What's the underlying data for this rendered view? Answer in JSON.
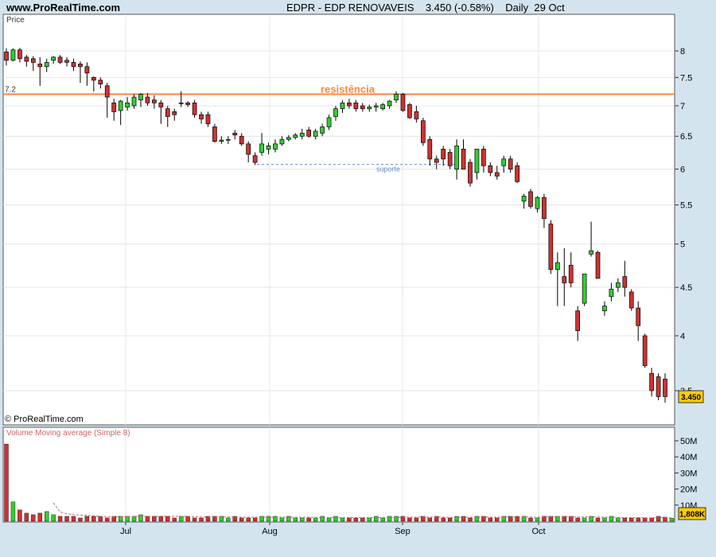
{
  "header": {
    "site": "www.ProRealTime.com",
    "ticker": "EDPR - EDP RENOVAVEIS",
    "quote": "3.450 (-0.58%)",
    "period": "Daily",
    "date": "29 Oct"
  },
  "price_panel": {
    "label": "Price",
    "copyright": "© ProRealTime.com",
    "resistance_label": "resistência",
    "resistance_level_label": "7.2",
    "support_label": "suporte",
    "last_price_tag": "3.450",
    "colors": {
      "up": "#33cc33",
      "down": "#cc3333",
      "resistance": "#ff8833",
      "support": "#6688cc"
    }
  },
  "volume_panel": {
    "label": "Volume Moving average (Simple 8)",
    "last_volume_tag": "1,808K"
  },
  "chart_data": {
    "type": "candlestick",
    "title": "EDPR - EDP RENOVAVEIS",
    "ylim": [
      3.35,
      8.4
    ],
    "y_ticks": [
      "8",
      "7.5",
      "7",
      "6.5",
      "6",
      "5.5",
      "5",
      "4.5",
      "4",
      "3.5"
    ],
    "x_ticks": [
      "Jul",
      "Aug",
      "Sep",
      "Oct"
    ],
    "resistance": 7.2,
    "support": 6.07,
    "volume_ticks": [
      "50M",
      "40M",
      "30M",
      "20M",
      "10M"
    ],
    "candles": [
      [
        7.98,
        8.05,
        7.72,
        7.82
      ],
      [
        7.82,
        8.05,
        7.8,
        8.02
      ],
      [
        8.02,
        8.06,
        7.78,
        7.85
      ],
      [
        7.88,
        7.92,
        7.7,
        7.8
      ],
      [
        7.85,
        7.9,
        7.62,
        7.78
      ],
      [
        7.75,
        7.88,
        7.35,
        7.7
      ],
      [
        7.7,
        7.85,
        7.6,
        7.78
      ],
      [
        7.82,
        7.9,
        7.75,
        7.88
      ],
      [
        7.88,
        7.92,
        7.75,
        7.78
      ],
      [
        7.82,
        7.88,
        7.7,
        7.78
      ],
      [
        7.78,
        7.85,
        7.62,
        7.7
      ],
      [
        7.75,
        7.8,
        7.4,
        7.7
      ],
      [
        7.7,
        7.78,
        7.35,
        7.58
      ],
      [
        7.5,
        7.52,
        7.25,
        7.45
      ],
      [
        7.45,
        7.5,
        7.3,
        7.38
      ],
      [
        7.35,
        7.4,
        6.8,
        7.15
      ],
      [
        7.05,
        7.12,
        6.75,
        6.9
      ],
      [
        6.92,
        7.1,
        6.68,
        7.08
      ],
      [
        6.98,
        7.15,
        6.92,
        7.05
      ],
      [
        7.0,
        7.2,
        6.95,
        7.15
      ],
      [
        7.1,
        7.22,
        6.98,
        7.2
      ],
      [
        7.15,
        7.22,
        7.0,
        7.05
      ],
      [
        7.1,
        7.18,
        6.95,
        7.05
      ],
      [
        7.05,
        7.1,
        6.7,
        6.98
      ],
      [
        6.95,
        7.0,
        6.65,
        6.82
      ],
      [
        6.9,
        6.95,
        6.75,
        6.85
      ],
      [
        7.05,
        7.25,
        6.98,
        7.05
      ],
      [
        7.05,
        7.08,
        6.98,
        7.02
      ],
      [
        7.05,
        7.1,
        6.8,
        6.85
      ],
      [
        6.85,
        6.9,
        6.7,
        6.78
      ],
      [
        6.85,
        6.9,
        6.65,
        6.7
      ],
      [
        6.65,
        6.7,
        6.4,
        6.42
      ],
      [
        6.42,
        6.5,
        6.38,
        6.44
      ],
      [
        6.45,
        6.5,
        6.38,
        6.45
      ],
      [
        6.55,
        6.6,
        6.45,
        6.52
      ],
      [
        6.5,
        6.55,
        6.35,
        6.38
      ],
      [
        6.38,
        6.42,
        6.1,
        6.22
      ],
      [
        6.2,
        6.25,
        6.06,
        6.1
      ],
      [
        6.25,
        6.55,
        6.2,
        6.38
      ],
      [
        6.3,
        6.4,
        6.22,
        6.35
      ],
      [
        6.3,
        6.45,
        6.25,
        6.38
      ],
      [
        6.38,
        6.5,
        6.35,
        6.45
      ],
      [
        6.45,
        6.52,
        6.42,
        6.48
      ],
      [
        6.48,
        6.55,
        6.45,
        6.52
      ],
      [
        6.5,
        6.62,
        6.45,
        6.55
      ],
      [
        6.6,
        6.65,
        6.48,
        6.5
      ],
      [
        6.5,
        6.62,
        6.45,
        6.58
      ],
      [
        6.55,
        6.7,
        6.5,
        6.65
      ],
      [
        6.65,
        6.85,
        6.6,
        6.8
      ],
      [
        6.82,
        7.0,
        6.75,
        6.95
      ],
      [
        6.95,
        7.1,
        6.88,
        7.05
      ],
      [
        7.05,
        7.12,
        6.95,
        7.0
      ],
      [
        7.05,
        7.1,
        6.9,
        6.95
      ],
      [
        7.0,
        7.05,
        6.9,
        6.95
      ],
      [
        6.95,
        7.02,
        6.9,
        6.98
      ],
      [
        6.98,
        7.05,
        6.9,
        7.0
      ],
      [
        6.95,
        7.05,
        6.92,
        7.02
      ],
      [
        7.0,
        7.1,
        6.95,
        7.08
      ],
      [
        7.1,
        7.25,
        7.05,
        7.2
      ],
      [
        7.2,
        7.22,
        6.9,
        6.92
      ],
      [
        7.02,
        7.05,
        6.78,
        6.8
      ],
      [
        6.9,
        7.0,
        6.72,
        6.78
      ],
      [
        6.75,
        6.8,
        6.35,
        6.4
      ],
      [
        6.45,
        6.5,
        6.05,
        6.15
      ],
      [
        6.15,
        6.2,
        6.0,
        6.1
      ],
      [
        6.3,
        6.35,
        6.05,
        6.15
      ],
      [
        6.25,
        6.3,
        6.0,
        6.05
      ],
      [
        6.0,
        6.45,
        5.85,
        6.35
      ],
      [
        6.3,
        6.45,
        6.0,
        6.0
      ],
      [
        6.1,
        6.15,
        5.75,
        5.8
      ],
      [
        5.95,
        6.3,
        5.85,
        6.3
      ],
      [
        6.3,
        6.35,
        5.95,
        6.05
      ],
      [
        6.05,
        6.1,
        5.9,
        5.95
      ],
      [
        5.95,
        6.05,
        5.85,
        5.9
      ],
      [
        6.05,
        6.2,
        5.95,
        6.15
      ],
      [
        6.15,
        6.2,
        5.95,
        6.0
      ],
      [
        6.05,
        6.1,
        5.8,
        5.82
      ],
      [
        5.55,
        5.65,
        5.45,
        5.62
      ],
      [
        5.68,
        5.72,
        5.45,
        5.48
      ],
      [
        5.45,
        5.62,
        5.4,
        5.6
      ],
      [
        5.6,
        5.65,
        5.2,
        5.32
      ],
      [
        5.25,
        5.3,
        4.65,
        4.7
      ],
      [
        4.7,
        4.9,
        4.3,
        4.78
      ],
      [
        4.62,
        4.95,
        4.3,
        4.55
      ],
      [
        4.75,
        4.9,
        4.5,
        4.55
      ],
      [
        4.25,
        4.3,
        3.95,
        4.05
      ],
      [
        4.33,
        4.65,
        4.3,
        4.65
      ],
      [
        4.88,
        5.28,
        4.85,
        4.92
      ],
      [
        4.9,
        4.92,
        4.65,
        4.6
      ],
      [
        4.25,
        4.35,
        4.2,
        4.3
      ],
      [
        4.4,
        4.55,
        4.35,
        4.48
      ],
      [
        4.5,
        4.6,
        4.45,
        4.55
      ],
      [
        4.62,
        4.8,
        4.4,
        4.5
      ],
      [
        4.45,
        4.48,
        4.25,
        4.28
      ],
      [
        4.28,
        4.35,
        3.95,
        4.1
      ],
      [
        4.0,
        4.02,
        3.7,
        3.72
      ],
      [
        3.65,
        3.7,
        3.45,
        3.5
      ],
      [
        3.62,
        3.65,
        3.42,
        3.45
      ],
      [
        3.6,
        3.65,
        3.4,
        3.45
      ]
    ],
    "volume_millions": [
      48,
      12,
      7,
      5,
      4,
      5,
      6,
      4,
      3,
      3,
      3,
      2,
      3,
      3,
      3,
      2,
      3,
      3,
      3,
      3,
      4,
      3,
      3,
      3,
      3,
      2,
      3,
      3,
      2,
      2,
      3,
      3,
      3,
      2,
      3,
      2,
      2,
      2,
      3,
      3,
      3,
      2,
      3,
      2,
      2,
      2,
      2,
      3,
      2,
      3,
      2,
      2,
      2,
      2,
      2,
      3,
      2,
      3,
      3,
      3,
      2,
      2,
      3,
      2,
      3,
      2,
      2,
      3,
      3,
      2,
      3,
      3,
      2,
      2,
      3,
      3,
      3,
      3,
      2,
      2,
      3,
      3,
      3,
      3,
      3,
      2,
      2,
      3,
      2,
      2,
      3,
      2,
      2,
      2,
      2,
      2,
      2,
      3,
      2.5,
      1.8
    ]
  }
}
